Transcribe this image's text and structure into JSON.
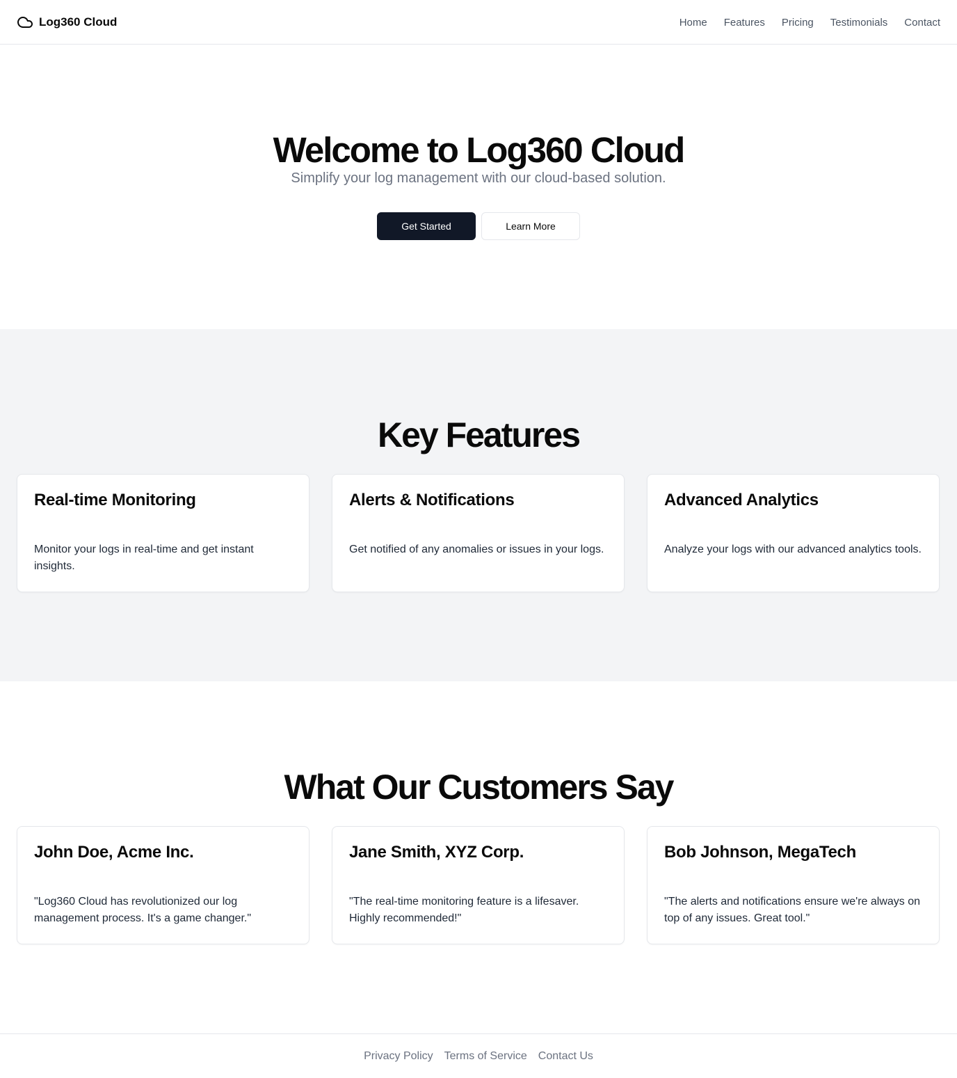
{
  "header": {
    "brand": "Log360 Cloud",
    "logo_icon": "cloud-icon",
    "nav": [
      "Home",
      "Features",
      "Pricing",
      "Testimonials",
      "Contact"
    ]
  },
  "hero": {
    "title": "Welcome to Log360 Cloud",
    "subtitle": "Simplify your log management with our cloud-based solution.",
    "primary_button": "Get Started",
    "secondary_button": "Learn More"
  },
  "features": {
    "title": "Key Features",
    "items": [
      {
        "title": "Real-time Monitoring",
        "text": "Monitor your logs in real-time and get instant insights."
      },
      {
        "title": "Alerts & Notifications",
        "text": "Get notified of any anomalies or issues in your logs."
      },
      {
        "title": "Advanced Analytics",
        "text": "Analyze your logs with our advanced analytics tools."
      }
    ]
  },
  "testimonials": {
    "title": "What Our Customers Say",
    "items": [
      {
        "author": "John Doe, Acme Inc.",
        "quote": "\"Log360 Cloud has revolutionized our log management process. It's a game changer.\""
      },
      {
        "author": "Jane Smith, XYZ Corp.",
        "quote": "\"The real-time monitoring feature is a lifesaver. Highly recommended!\""
      },
      {
        "author": "Bob Johnson, MegaTech",
        "quote": "\"The alerts and notifications ensure we're always on top of any issues. Great tool.\""
      }
    ]
  },
  "footer": {
    "links": [
      "Privacy Policy",
      "Terms of Service",
      "Contact Us"
    ]
  },
  "colors": {
    "primary_button": "#111827",
    "section_background": "#f3f4f6",
    "muted_text": "#6b7280"
  }
}
